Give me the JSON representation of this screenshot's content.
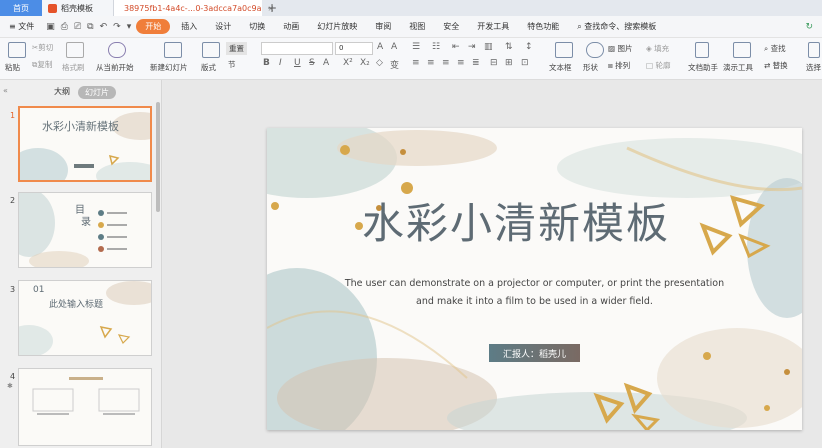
{
  "tabs": {
    "home": "首页",
    "doc": "稻壳模板",
    "active": "38975fb1-4a4c-...0-3adcca7a0c9a",
    "active_close": "×",
    "plus": "+"
  },
  "menu": {
    "file": "≡ 文件",
    "items": [
      "开始",
      "插入",
      "设计",
      "切换",
      "动画",
      "幻灯片放映",
      "审阅",
      "视图",
      "安全",
      "开发工具",
      "特色功能"
    ],
    "search": "查找命令、搜索模板"
  },
  "ribbon": {
    "paste": "粘贴",
    "cut": "剪切",
    "copy": "复制",
    "format_painter": "格式刷",
    "from_current": "从当前开始",
    "new_slide": "新建幻灯片",
    "layout": "版式",
    "section": "节",
    "reset": "重置",
    "font_size": "0",
    "text_box": "文本框",
    "shape": "形状",
    "picture": "图片",
    "arrange": "排列",
    "fill": "填充",
    "outline": "轮廓",
    "doc_helper": "文档助手",
    "presenter": "演示工具",
    "find": "查找",
    "replace": "替换",
    "select": "选择"
  },
  "pane": {
    "outline_tab": "大纲",
    "slides_tab": "幻灯片",
    "thumb_numbers": [
      "1",
      "2",
      "3",
      "4"
    ],
    "thumb1_title": "水彩小清新模板",
    "thumb2_heading": "目",
    "thumb2_heading2": "录",
    "thumb3_number": "01",
    "thumb3_title": "此处输入标题"
  },
  "slide": {
    "title": "水彩小清新模板",
    "subtitle_line1": "The user can demonstrate on a projector or computer, or print the presentation",
    "subtitle_line2": "and make it into a film to be used in a wider field.",
    "reporter": "汇报人：稻壳儿"
  },
  "colors": {
    "accent_orange": "#f07e3a",
    "home_tab": "#4c8de6",
    "title_gray": "#5e6b74",
    "gold": "#d7a84c"
  }
}
